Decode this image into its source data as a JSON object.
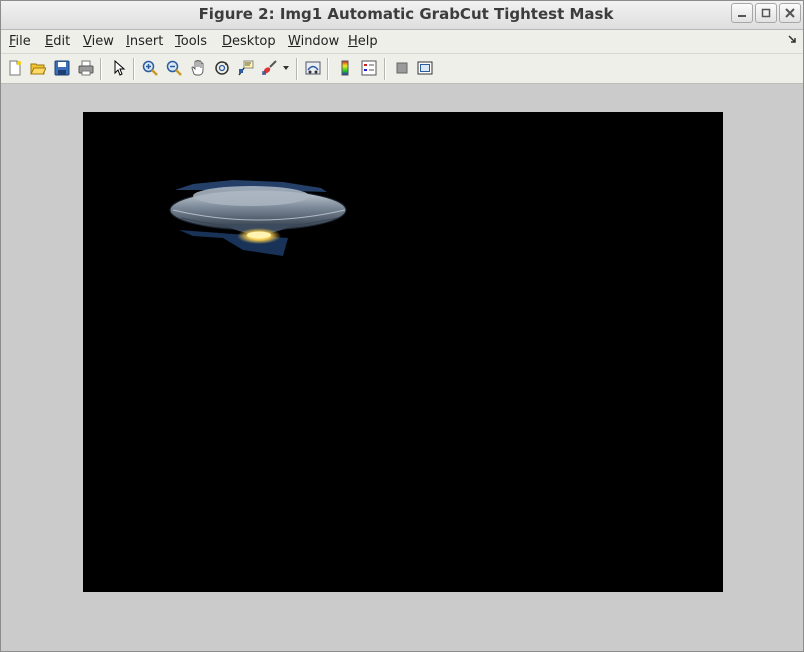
{
  "window": {
    "title": "Figure 2: Img1 Automatic GrabCut Tightest Mask",
    "controls": [
      "minimize-icon",
      "maximize-icon",
      "close-icon"
    ]
  },
  "menu": {
    "file": {
      "u": "F",
      "rest": "ile"
    },
    "edit": {
      "u": "E",
      "rest": "dit"
    },
    "view": {
      "u": "V",
      "rest": "iew"
    },
    "insert": {
      "u": "I",
      "rest": "nsert"
    },
    "tools": {
      "u": "T",
      "rest": "ools"
    },
    "desktop": {
      "u": "D",
      "rest": "esktop"
    },
    "window": {
      "u": "W",
      "rest": "indow"
    },
    "help": {
      "u": "H",
      "rest": "elp"
    }
  },
  "toolbar": {
    "icons": [
      "new-figure-icon",
      "open-file-icon",
      "save-icon",
      "print-icon",
      "edit-plot-arrow-icon",
      "zoom-in-icon",
      "zoom-out-icon",
      "pan-hand-icon",
      "rotate-3d-icon",
      "data-cursor-icon",
      "brush-icon",
      "link-plot-icon",
      "colorbar-icon",
      "legend-icon",
      "hide-plot-tools-icon",
      "show-plot-tools-icon"
    ]
  },
  "image": {
    "content": "ufo-saucer",
    "background_color": "#000000"
  }
}
